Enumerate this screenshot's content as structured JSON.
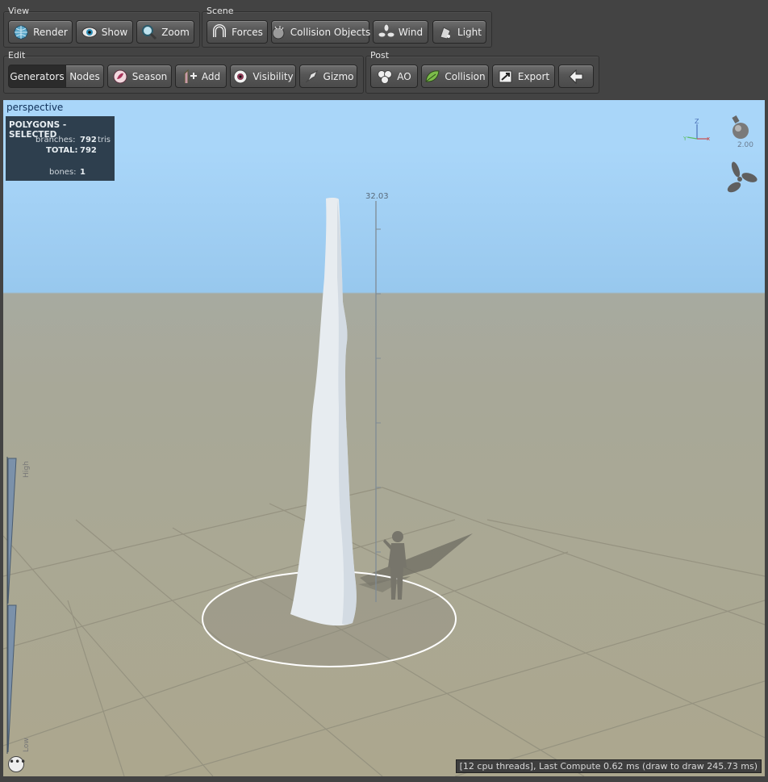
{
  "groups": {
    "view": "View",
    "scene": "Scene",
    "edit": "Edit",
    "post": "Post"
  },
  "toolbar": {
    "render": "Render",
    "show": "Show",
    "zoom": "Zoom",
    "forces": "Forces",
    "collision_objects": "Collision Objects",
    "wind": "Wind",
    "light": "Light",
    "generators": "Generators",
    "nodes": "Nodes",
    "season": "Season",
    "add": "Add",
    "visibility": "Visibility",
    "gizmo": "Gizmo",
    "ao": "AO",
    "collision": "Collision",
    "export": "Export"
  },
  "viewport": {
    "label": "perspective",
    "height_marker": "32.03",
    "light_scale": "2.00",
    "lod_high": "High",
    "lod_low": "Low",
    "menu_glyph": "•••",
    "status": "[12 cpu threads], Last Compute 0.62 ms (draw to draw 245.73 ms)"
  },
  "stats": {
    "title": "POLYGONS - SELECTED",
    "branches_label": "branches:",
    "branches_value": "792",
    "branches_unit": "tris",
    "total_label": "TOTAL:",
    "total_value": "792",
    "bones_label": "bones:",
    "bones_value": "1"
  },
  "colors": {
    "sky": "#a9d6f9",
    "ground": "#aca78e",
    "panel": "#464646",
    "stats_bg": "#2e3f4e",
    "trunk": "#e6ebef"
  },
  "icons": [
    "globe-icon",
    "eye-icon",
    "magnifier-icon",
    "magnet-icon",
    "collision-sphere-icon",
    "fan-icon",
    "lamp-icon",
    "season-icon",
    "add-node-icon",
    "visibility-eye-icon",
    "gizmo-icon",
    "ao-icon",
    "leaf-icon",
    "export-icon",
    "back-arrow-icon",
    "light-bulb-icon",
    "propeller-icon",
    "axis-gizmo-icon"
  ]
}
